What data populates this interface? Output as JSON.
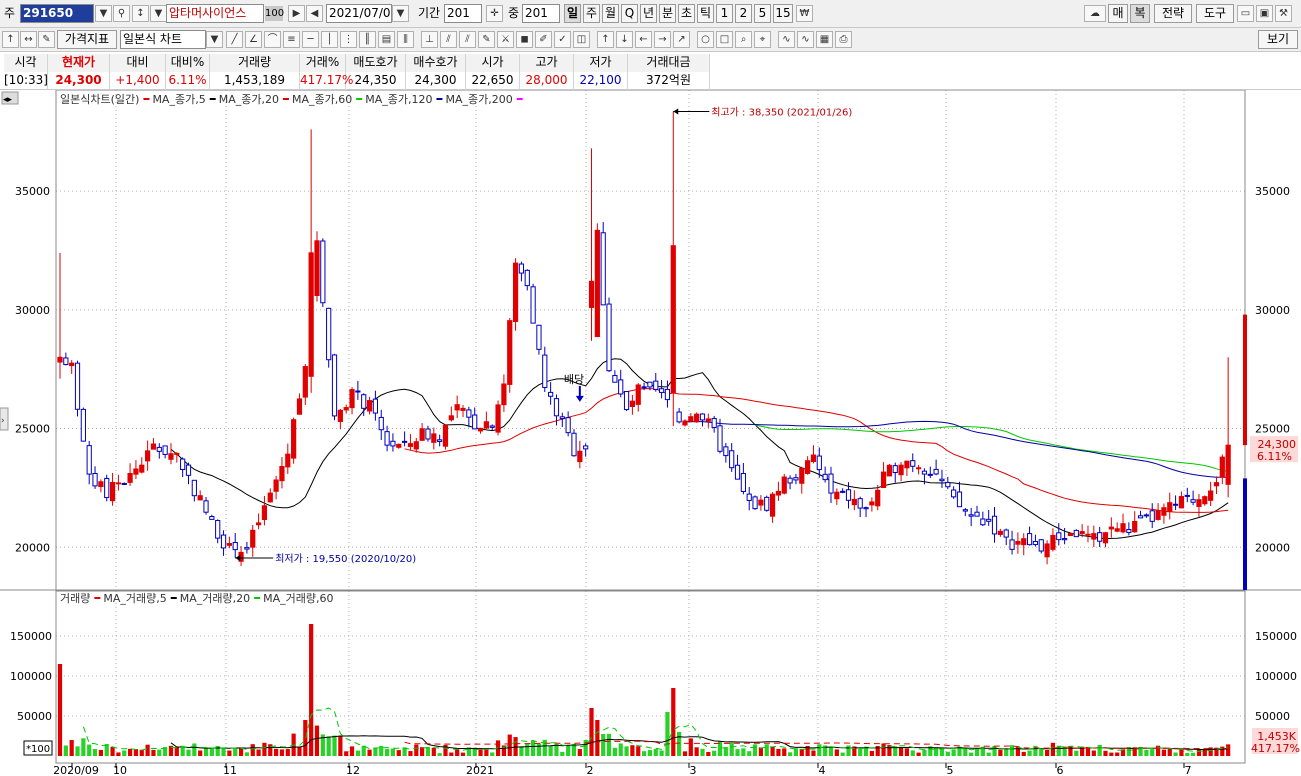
{
  "toolbar1": {
    "prefix": "주",
    "code": "291650",
    "name": "압타머사이언스",
    "name_badge": "100",
    "date": "2021/07/09",
    "period_label": "기간",
    "period_value": "201",
    "zoom_label": "중",
    "zoom_value": "201",
    "intervals": [
      "일",
      "주",
      "월",
      "Q",
      "년",
      "분",
      "초",
      "틱",
      "1",
      "2",
      "5",
      "15"
    ],
    "selected_interval": "일",
    "right_buttons": [
      "매",
      "복",
      "전략",
      "도구"
    ]
  },
  "toolbar2": {
    "indicator_button": "가격지표",
    "chart_type": "일본식 차트",
    "view_button": "보기"
  },
  "quote": {
    "headers": [
      "시각",
      "현재가",
      "대비",
      "대비%",
      "거래량",
      "거래%",
      "매도호가",
      "매수호가",
      "시가",
      "고가",
      "저가",
      "거래대금"
    ],
    "values": [
      "[10:33]",
      "24,300",
      "+1,400",
      "6.11%",
      "1,453,189",
      "417.17%",
      "24,350",
      "24,300",
      "22,650",
      "28,000",
      "22,100",
      "372억원"
    ]
  },
  "legend_price": {
    "title": "일본식차트(일간)",
    "items": [
      {
        "label": "MA_종가,5",
        "color": "#e00000"
      },
      {
        "label": "MA_종가,20",
        "color": "#000000"
      },
      {
        "label": "MA_종가,60",
        "color": "#e00000"
      },
      {
        "label": "MA_종가,120",
        "color": "#00c800"
      },
      {
        "label": "MA_종가,200",
        "color": "#0000a0"
      }
    ],
    "end_color": "#ff00ff"
  },
  "legend_volume": {
    "title": "거래량",
    "items": [
      {
        "label": "MA_거래량,5",
        "color": "#e00000"
      },
      {
        "label": "MA_거래량,20",
        "color": "#000000"
      },
      {
        "label": "MA_거래량,60",
        "color": "#00c800"
      }
    ]
  },
  "annotations": {
    "high": "최고가 : 38,350 (2021/01/26)",
    "low": "최저가 : 19,550 (2020/10/20)",
    "dividend": "배당"
  },
  "price_badge": {
    "price": "24,300",
    "pct": "6.11%"
  },
  "volume_badge": {
    "volume": "1,453K",
    "pct": "417.17%"
  },
  "scale_label": "*100",
  "colors": {
    "up": "#e00000",
    "down": "#0000c0",
    "ma20": "#000000",
    "ma60": "#e00000",
    "ma120": "#00c800",
    "ma200": "#0000a0"
  },
  "chart_data": {
    "type": "candlestick",
    "price_axis": {
      "ticks": [
        20000,
        25000,
        30000,
        35000
      ],
      "labels": [
        "20000",
        "25000",
        "30000",
        "35000"
      ],
      "range": [
        18200,
        38500
      ]
    },
    "volume_axis": {
      "ticks": [
        50000,
        100000,
        150000
      ],
      "labels": [
        "50000",
        "100000",
        "150000"
      ],
      "range": [
        0,
        185000
      ]
    },
    "x_labels": [
      "2020/09",
      "10",
      "11",
      "12",
      "2021",
      "2",
      "3",
      "4",
      "5",
      "6",
      "7"
    ],
    "bars": 201,
    "anchor_closes": [
      [
        0,
        28000
      ],
      [
        2,
        27700
      ],
      [
        5,
        22800
      ],
      [
        8,
        22300
      ],
      [
        12,
        23000
      ],
      [
        16,
        24200
      ],
      [
        20,
        23900
      ],
      [
        26,
        21000
      ],
      [
        29,
        19900
      ],
      [
        32,
        19900
      ],
      [
        36,
        22200
      ],
      [
        39,
        24000
      ],
      [
        42,
        27800
      ],
      [
        44,
        33000
      ],
      [
        47,
        25500
      ],
      [
        50,
        26500
      ],
      [
        53,
        25900
      ],
      [
        56,
        24400
      ],
      [
        59,
        24200
      ],
      [
        62,
        24800
      ],
      [
        65,
        24700
      ],
      [
        68,
        25800
      ],
      [
        71,
        25200
      ],
      [
        74,
        25300
      ],
      [
        76,
        26900
      ],
      [
        78,
        31900
      ],
      [
        80,
        31200
      ],
      [
        83,
        26700
      ],
      [
        86,
        25200
      ],
      [
        88,
        24100
      ],
      [
        90,
        24300
      ],
      [
        92,
        33200
      ],
      [
        94,
        27600
      ],
      [
        97,
        25700
      ],
      [
        99,
        26600
      ],
      [
        103,
        26400
      ],
      [
        106,
        25300
      ],
      [
        109,
        25800
      ],
      [
        112,
        24800
      ],
      [
        115,
        23200
      ],
      [
        118,
        21800
      ],
      [
        121,
        21800
      ],
      [
        124,
        22800
      ],
      [
        127,
        23100
      ],
      [
        129,
        23800
      ],
      [
        132,
        22200
      ],
      [
        135,
        22100
      ],
      [
        138,
        21500
      ],
      [
        141,
        22900
      ],
      [
        144,
        23700
      ],
      [
        147,
        23500
      ],
      [
        150,
        23100
      ],
      [
        153,
        21900
      ],
      [
        156,
        21300
      ],
      [
        159,
        21100
      ],
      [
        162,
        20200
      ],
      [
        165,
        20200
      ],
      [
        168,
        20000
      ],
      [
        171,
        20400
      ],
      [
        174,
        20600
      ],
      [
        177,
        20300
      ],
      [
        180,
        20800
      ],
      [
        183,
        20800
      ],
      [
        186,
        21100
      ],
      [
        189,
        21500
      ],
      [
        192,
        21900
      ],
      [
        195,
        22100
      ],
      [
        198,
        22900
      ],
      [
        200,
        24300
      ]
    ],
    "notable_candles": [
      {
        "index": 0,
        "open": 27800,
        "high": 32400,
        "low": 27100,
        "close": 28000
      },
      {
        "index": 43,
        "open": 27200,
        "high": 37600,
        "low": 26500,
        "close": 32400
      },
      {
        "index": 91,
        "open": 30100,
        "high": 36800,
        "low": 28700,
        "close": 31200
      },
      {
        "index": 105,
        "open": 26500,
        "high": 38350,
        "low": 25100,
        "close": 32700
      },
      {
        "index": 30,
        "open": 20200,
        "high": 20600,
        "low": 19550,
        "close": 19900
      },
      {
        "index": 200,
        "open": 22650,
        "high": 28000,
        "low": 22100,
        "close": 24300
      }
    ],
    "notable_volumes": [
      {
        "index": 0,
        "volume": 115000
      },
      {
        "index": 43,
        "volume": 165000
      },
      {
        "index": 105,
        "volume": 85000
      },
      {
        "index": 91,
        "volume": 60000
      },
      {
        "index": 200,
        "volume": 14532
      }
    ]
  }
}
